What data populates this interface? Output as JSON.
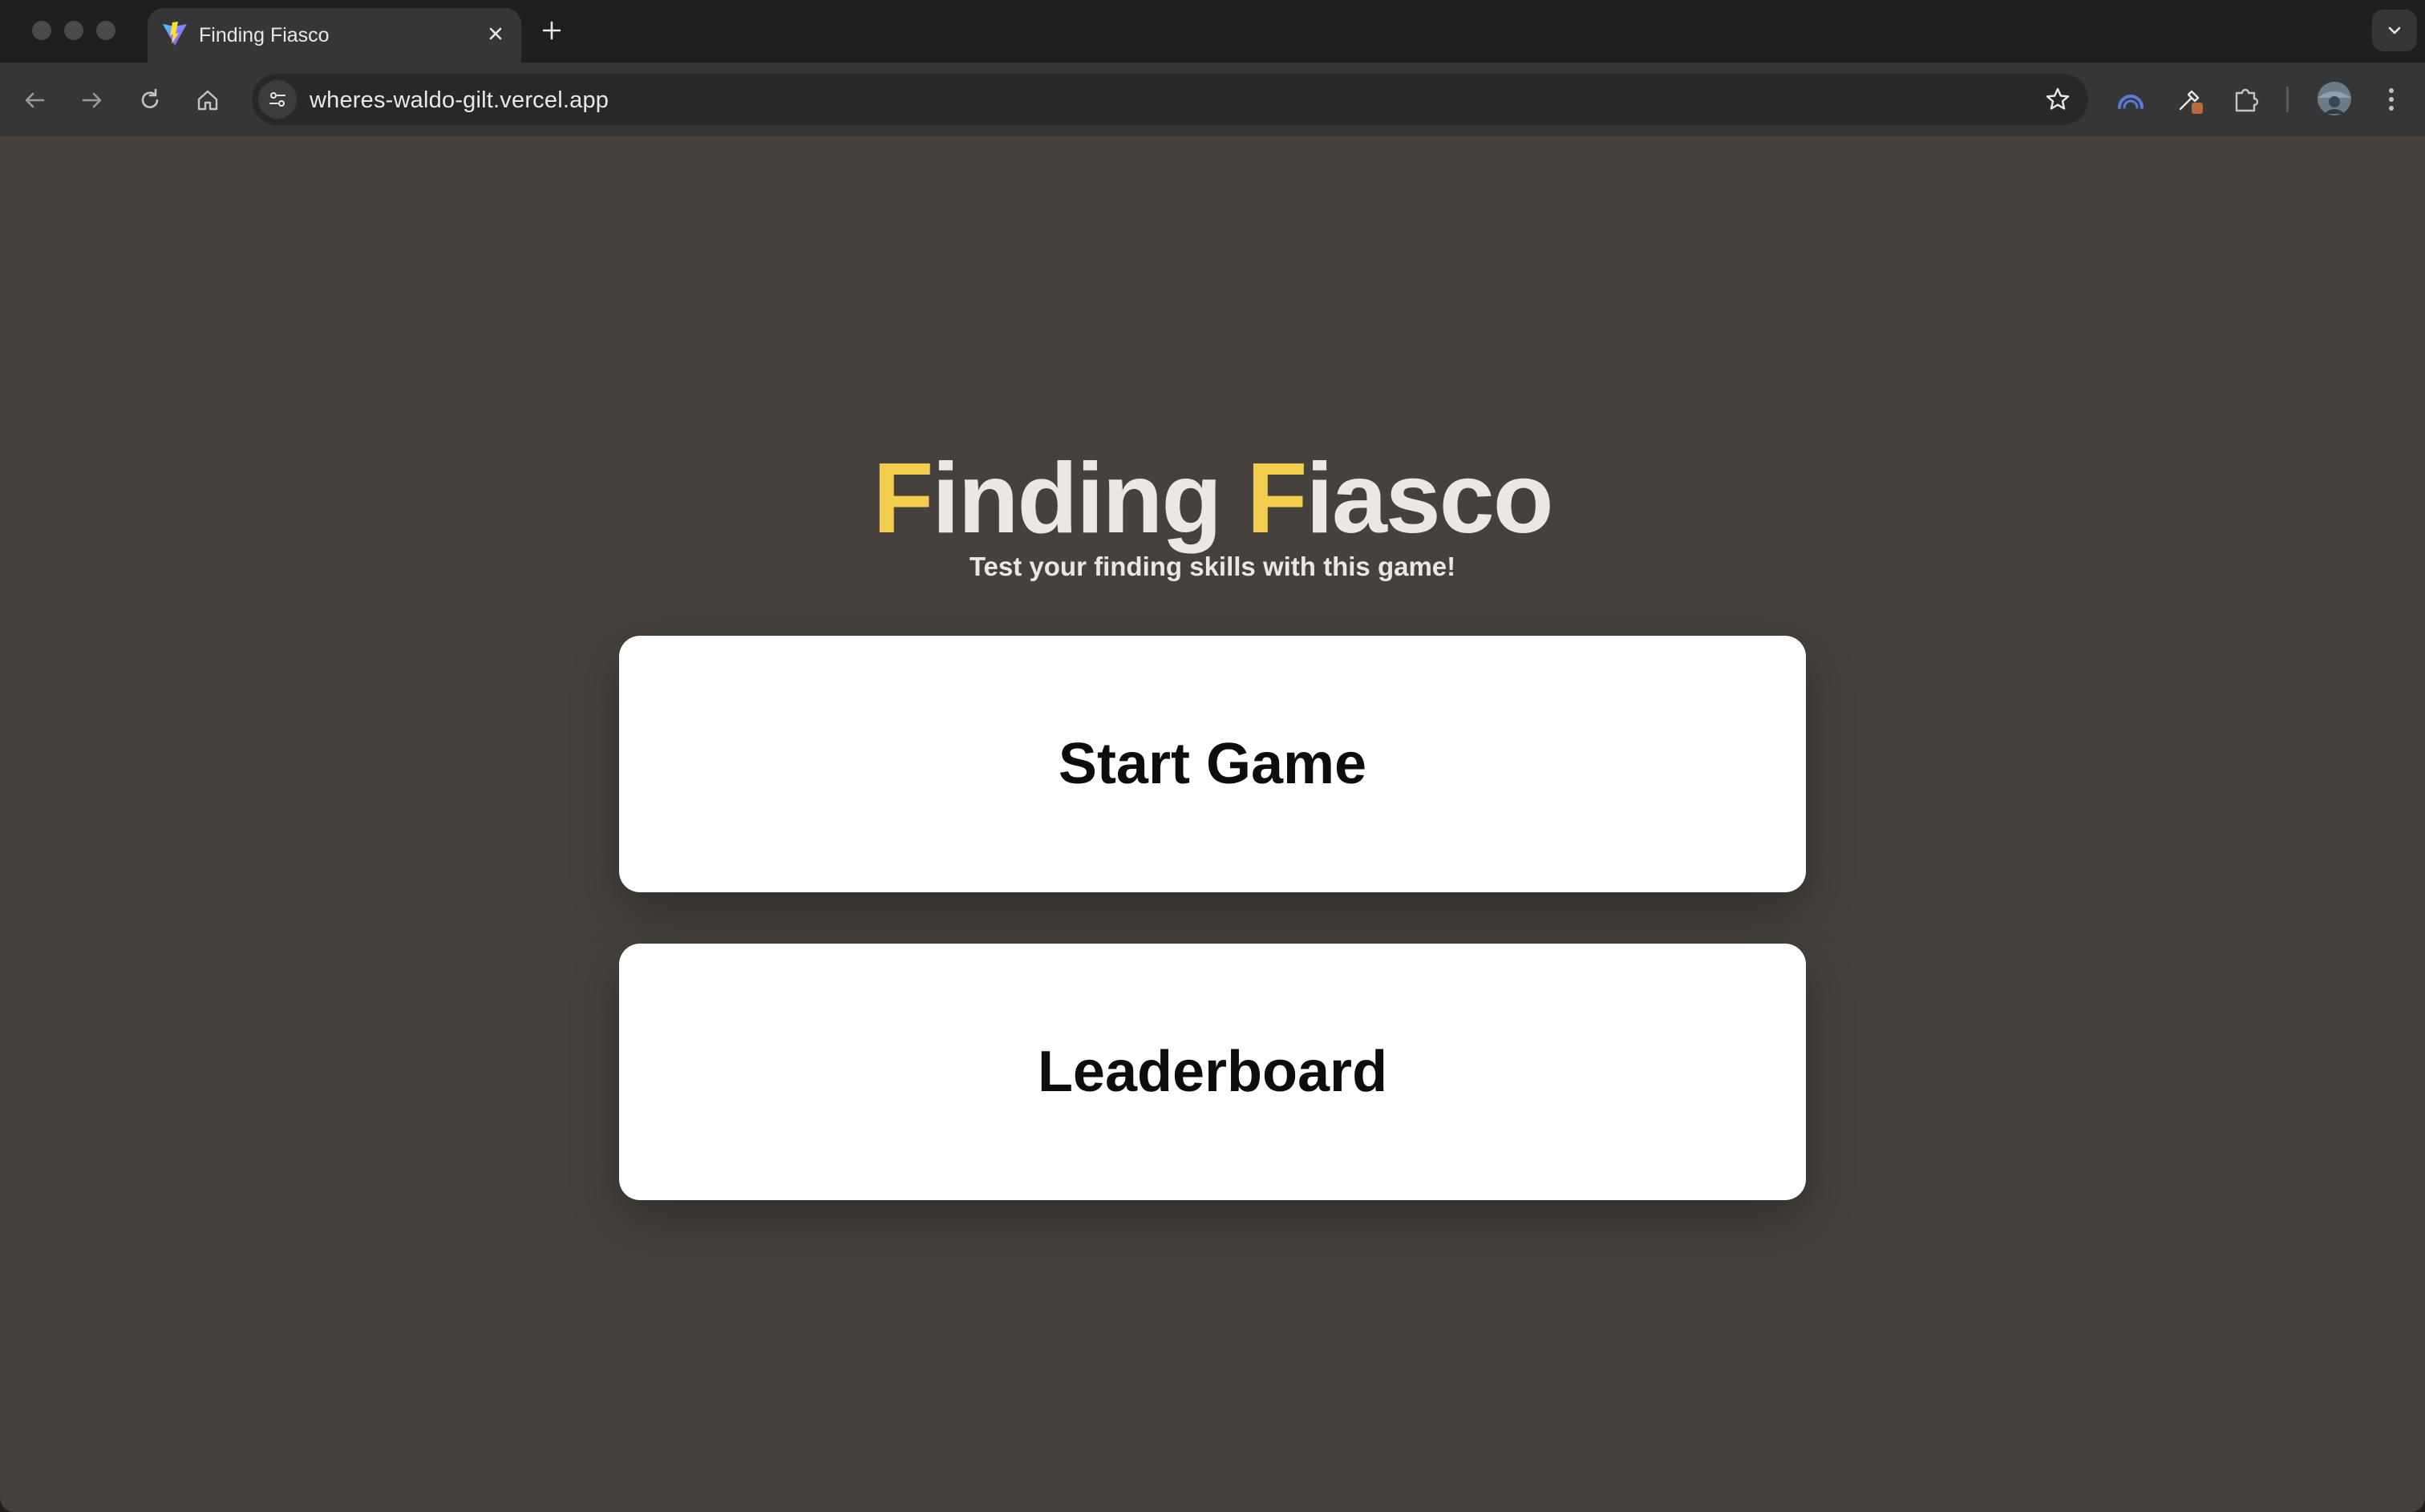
{
  "browser": {
    "tab": {
      "title": "Finding Fiasco",
      "favicon": "vite-logo-icon"
    },
    "url": "wheres-waldo-gilt.vercel.app",
    "colors": {
      "frame": "#1f1f1f",
      "toolbar": "#363636",
      "omnibox": "#282828"
    }
  },
  "page": {
    "title": {
      "part1_accent": "F",
      "part1_rest": "inding ",
      "part2_accent": "F",
      "part2_rest": "iasco"
    },
    "subtitle": "Test your finding skills with this game!",
    "buttons": {
      "start": "Start Game",
      "leaderboard": "Leaderboard"
    },
    "colors": {
      "background": "#46413c",
      "accent": "#f2cd4e",
      "title_text": "#ebe8e4",
      "button_bg": "#ffffff"
    }
  }
}
